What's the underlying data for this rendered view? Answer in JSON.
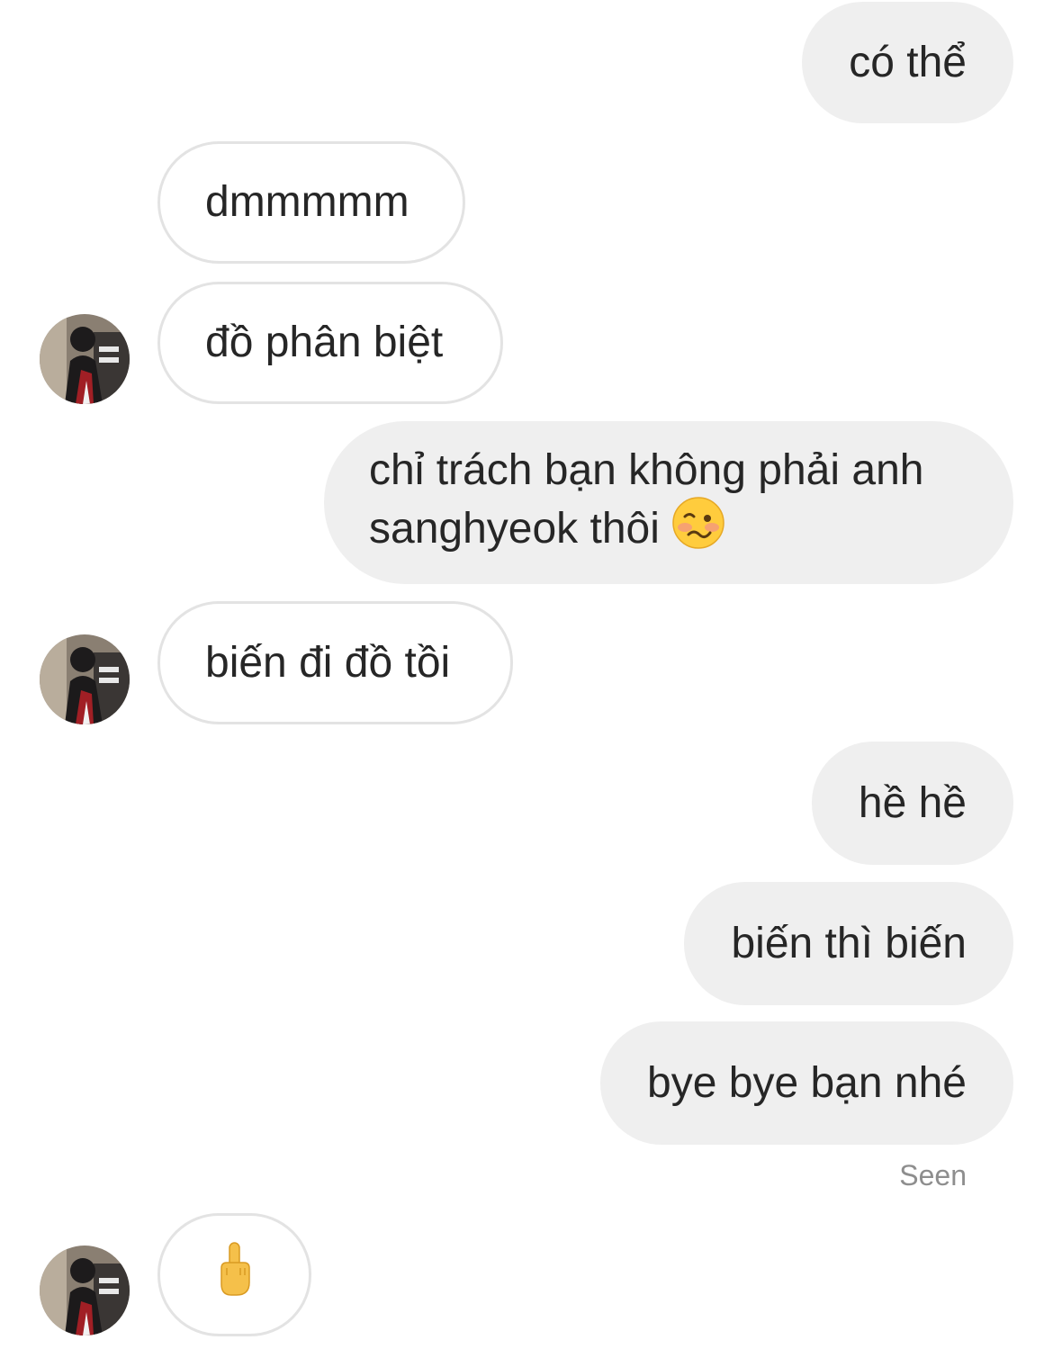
{
  "messages": [
    {
      "text": "có thể"
    },
    {
      "text": "dmmmmm"
    },
    {
      "text": "đồ phân biệt"
    },
    {
      "text_line1": "chỉ trách bạn không phải anh",
      "text_line2": "sanghyeok thôi",
      "emoji": "woozy-face-icon"
    },
    {
      "text": "biến đi đồ tồi"
    },
    {
      "text": "hề hề"
    },
    {
      "text": "biến thì biến"
    },
    {
      "text": "bye bye bạn nhé"
    },
    {
      "emoji": "middle-finger-icon"
    }
  ],
  "status": {
    "seen_label": "Seen"
  },
  "colors": {
    "sent_bubble": "#efefef",
    "received_border": "#e3e3e3",
    "text": "#262626",
    "seen_text": "#8e8e8e"
  }
}
